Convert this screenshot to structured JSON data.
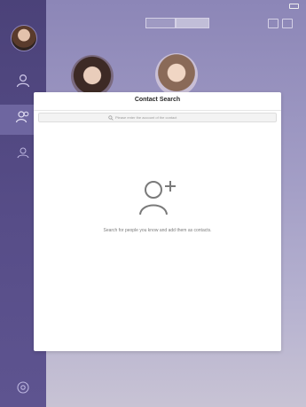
{
  "modal": {
    "title": "Contact Search",
    "search_placeholder": "Please enter the account of the contact",
    "empty_message": "Search for people you know and add them as contacts."
  },
  "icons": {
    "search": "search-icon",
    "add_person": "add-person-icon",
    "contacts": "contacts-icon",
    "settings": "settings-icon"
  },
  "colors": {
    "sidebar": "#4b4279",
    "sidebar_active": "#6e66a0",
    "background": "#a39ec6",
    "modal": "#ffffff",
    "icon_gray": "#7a7a7a"
  }
}
